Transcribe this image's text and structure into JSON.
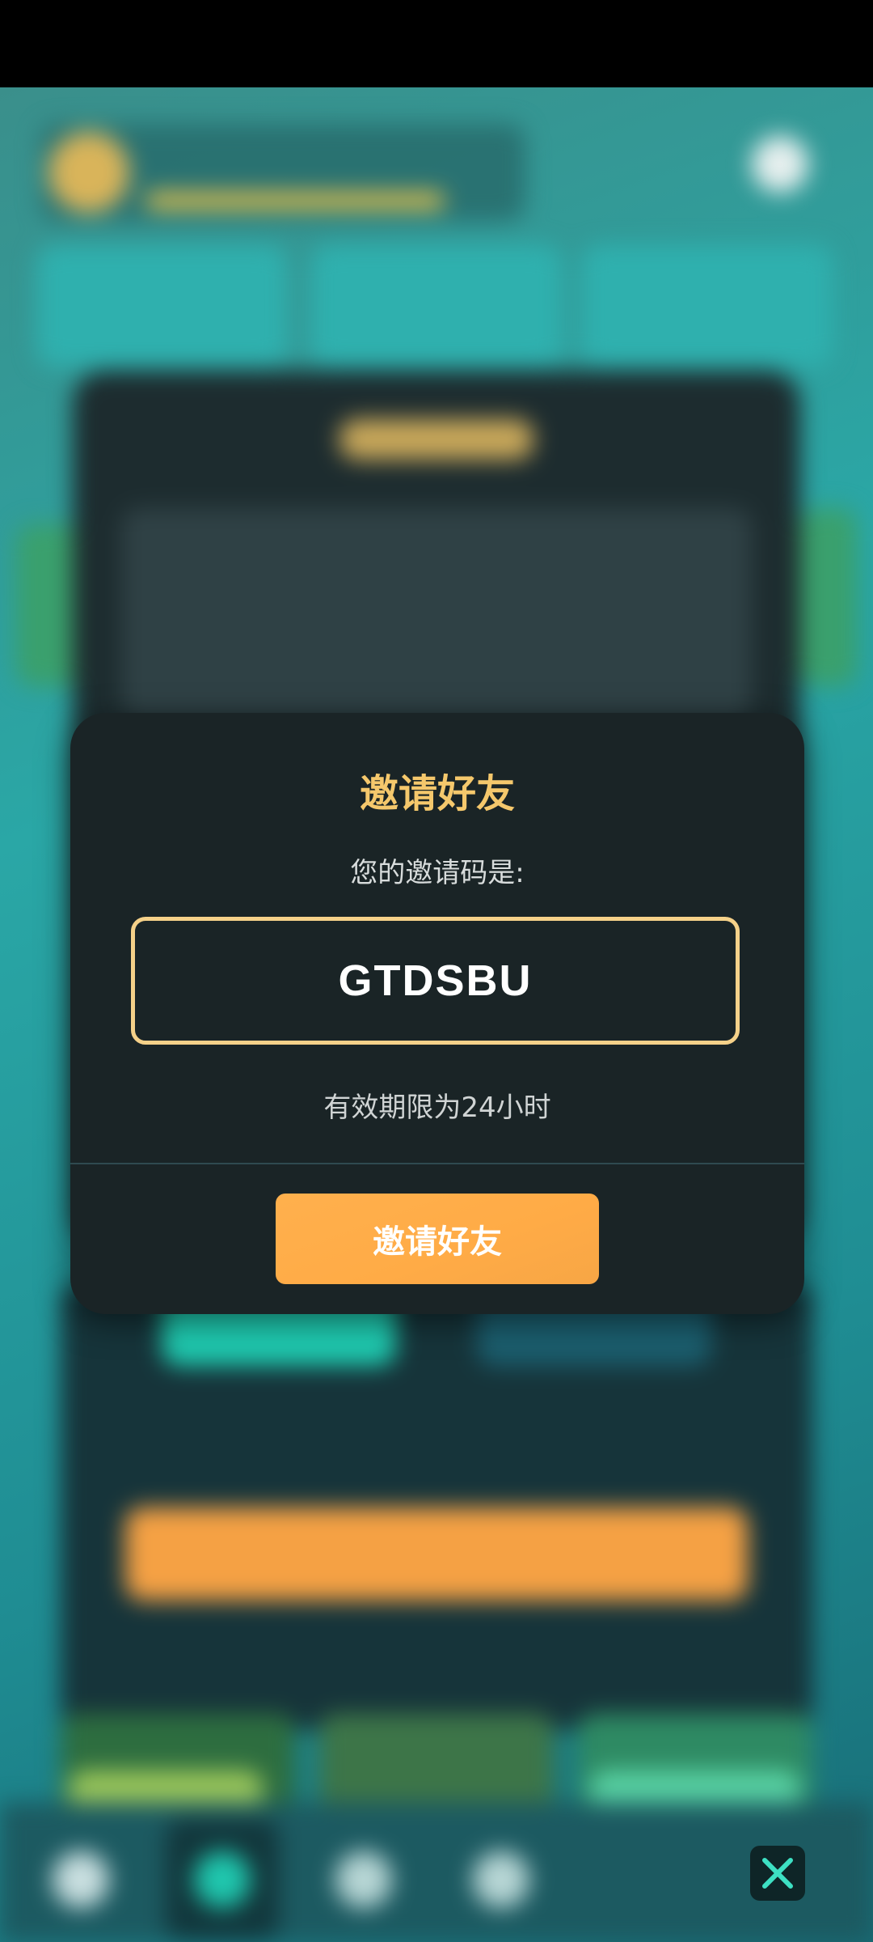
{
  "dialog": {
    "title": "邀请好友",
    "invite_label": "您的邀请码是:",
    "invite_code": "GTDSBU",
    "validity": "有效期限为24小时",
    "invite_button_label": "邀请好友"
  },
  "icons": {
    "close": "close-icon"
  },
  "colors": {
    "title": "#f5c86c",
    "code_border": "#f5d189",
    "button": "#ffab46",
    "close_icon": "#3de0c3"
  }
}
